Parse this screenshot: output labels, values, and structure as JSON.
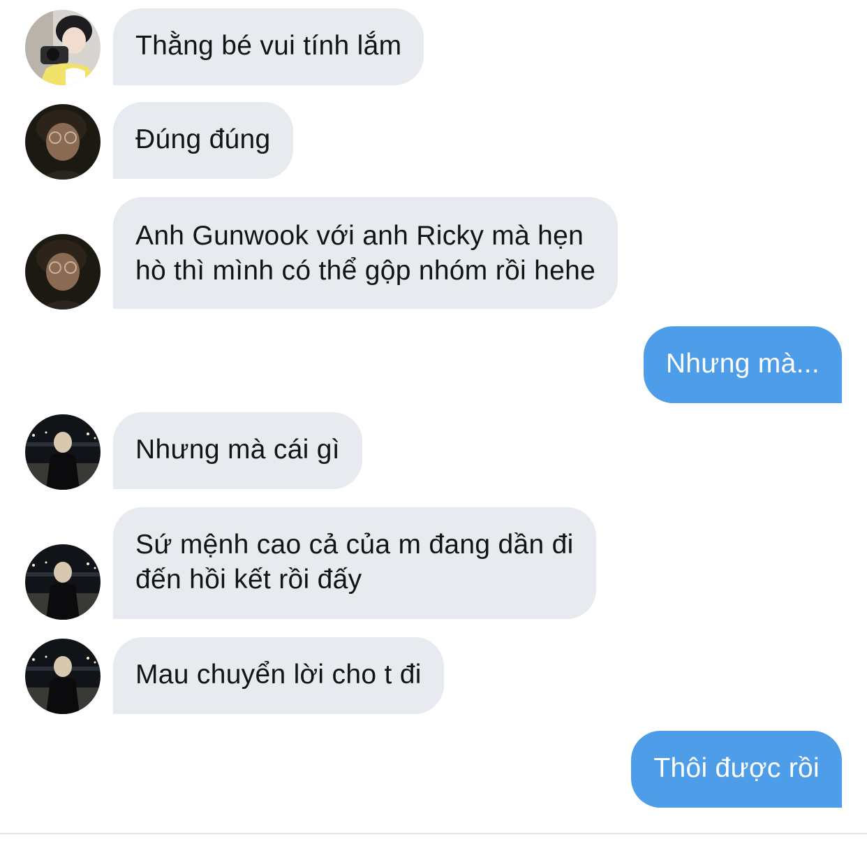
{
  "messages": [
    {
      "sender": "incoming",
      "lines": [
        "Thằng bé vui tính lắm"
      ]
    },
    {
      "sender": "incoming",
      "lines": [
        "Đúng đúng"
      ]
    },
    {
      "sender": "incoming",
      "lines": [
        "Anh Gunwook với anh Ricky mà hẹn",
        "hò thì mình có thể gộp nhóm rồi hehe"
      ]
    },
    {
      "sender": "outgoing",
      "lines": [
        "Nhưng mà..."
      ]
    },
    {
      "sender": "incoming",
      "lines": [
        "Nhưng mà cái gì"
      ]
    },
    {
      "sender": "incoming",
      "lines": [
        "Sứ mệnh cao cả của m đang dần đi",
        "đến hồi kết rồi đấy"
      ]
    },
    {
      "sender": "incoming",
      "lines": [
        "Mau chuyển lời cho t đi"
      ]
    },
    {
      "sender": "outgoing",
      "lines": [
        "Thôi được rồi"
      ]
    }
  ],
  "colors": {
    "incoming_bubble": "#e7eaee",
    "outgoing_bubble": "#4d9de8",
    "incoming_text": "#111316",
    "outgoing_text": "#ffffff"
  }
}
